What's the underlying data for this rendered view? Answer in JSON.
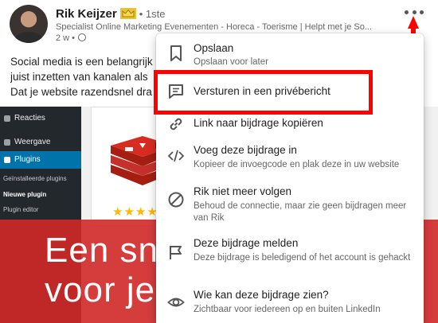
{
  "post": {
    "author": "Rik Keijzer",
    "degree": "• 1ste",
    "headline": "Specialist Online Marketing Evenementen - Horeca - Toerisme | Helpt met je So...",
    "time": "2 w •",
    "text_lines": [
      "Social media is een belangrijk",
      "juist inzetten van kanalen als",
      "Dat je website razendsnel dra"
    ]
  },
  "post_image": {
    "wp_menu": [
      "Reacties",
      "Weergave",
      "Plugins"
    ],
    "wp_submenu": [
      "Geïnstalleerde plugins",
      "Nieuwe plugin",
      "Plugin editor"
    ],
    "stars": "★★★★★",
    "banner_lines": [
      "Een sn",
      "voor je"
    ]
  },
  "menu": {
    "items": [
      {
        "title": "Opslaan",
        "subtitle": "Opslaan voor later",
        "icon": "bookmark-icon"
      },
      {
        "title": "Versturen in een privébericht",
        "subtitle": "",
        "icon": "message-icon"
      },
      {
        "title": "Link naar bijdrage kopiëren",
        "subtitle": "",
        "icon": "link-icon"
      },
      {
        "title": "Voeg deze bijdrage in",
        "subtitle": "Kopieer de invoegcode en plak deze in uw website",
        "icon": "embed-icon"
      },
      {
        "title": "Rik niet meer volgen",
        "subtitle": "Behoud de connectie, maar zie geen bijdragen meer van Rik",
        "icon": "unfollow-icon"
      },
      {
        "title": "Deze bijdrage melden",
        "subtitle": "Deze bijdrage is beledigend of het account is gehackt",
        "icon": "flag-icon"
      },
      {
        "title": "Wie kan deze bijdrage zien?",
        "subtitle": "Zichtbaar voor iedereen op en buiten LinkedIn",
        "icon": "eye-icon"
      }
    ]
  },
  "colors": {
    "annotation_red": "#ff0000",
    "icon_gray": "#555555",
    "wp_active": "#0073aa"
  }
}
